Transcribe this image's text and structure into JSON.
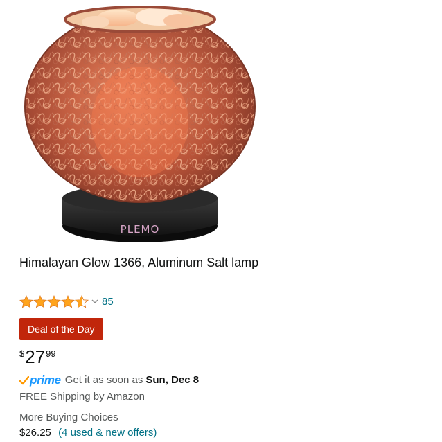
{
  "product": {
    "title": "Himalayan Glow 1366, Aluminum Salt lamp",
    "image_brand_text": "PLEMO",
    "rating": {
      "stars": 4.5,
      "count": "85"
    },
    "deal_badge": "Deal of the Day",
    "price": {
      "symbol": "$",
      "whole": "27",
      "fraction": "99"
    },
    "delivery": {
      "prime_label": "prime",
      "text": "Get it as soon as",
      "date": "Sun, Dec 8"
    },
    "shipping": "FREE Shipping by Amazon",
    "more_buying_choices": {
      "label": "More Buying Choices",
      "price": "$26.25",
      "offers_link": "(4 used & new offers)"
    }
  },
  "colors": {
    "star": "#ffa41c",
    "link": "#007185",
    "deal_badge": "#c1260b",
    "prime": "#1a98ff"
  },
  "icons": [
    "star-icon",
    "chevron-down-icon",
    "prime-check-icon"
  ]
}
